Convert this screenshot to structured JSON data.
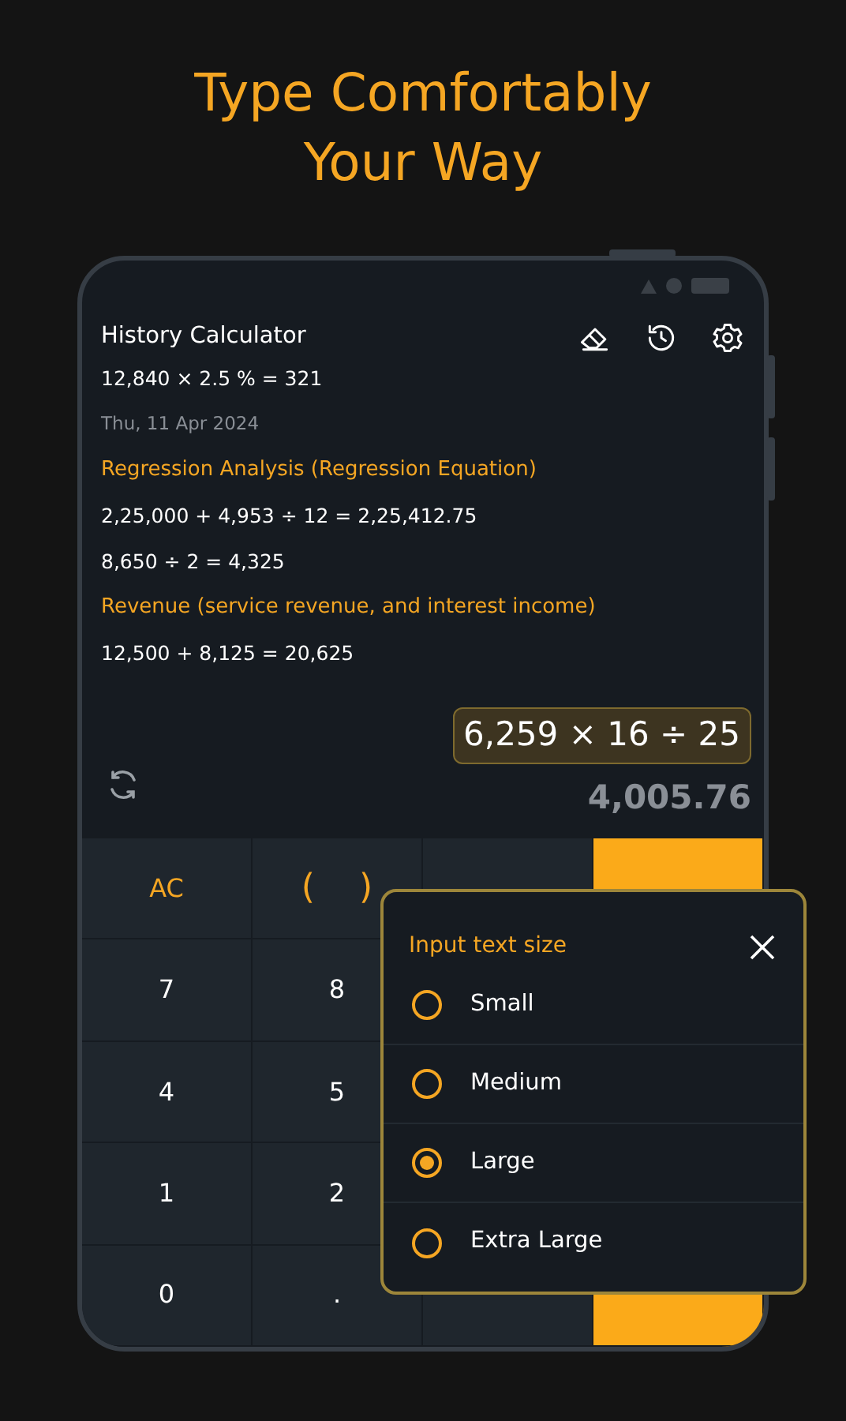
{
  "headline": [
    "Type Comfortably",
    "Your Way"
  ],
  "app": {
    "title": "History Calculator"
  },
  "history": [
    {
      "kind": "expression",
      "text": "12,840 × 2.5 % = 321"
    },
    {
      "kind": "date",
      "text": "Thu, 11 Apr 2024"
    },
    {
      "kind": "title",
      "text": "Regression Analysis (Regression Equation)"
    },
    {
      "kind": "expression",
      "text": "2,25,000 + 4,953 ÷ 12 = 2,25,412.75"
    },
    {
      "kind": "expression",
      "text": "8,650 ÷ 2 = 4,325"
    },
    {
      "kind": "title",
      "text": "Revenue (service revenue, and interest income)"
    },
    {
      "kind": "expression",
      "text": "12,500 + 8,125 = 20,625"
    }
  ],
  "display": {
    "expression": "6,259 × 16 ÷ 25",
    "result": "4,005.76"
  },
  "keypad": [
    [
      {
        "label": "AC",
        "kind": "function"
      },
      {
        "label": "(    )",
        "kind": "function"
      },
      {
        "kind": "function"
      },
      {
        "kind": "operator"
      }
    ],
    [
      {
        "label": "7",
        "kind": "digit"
      },
      {
        "label": "8",
        "kind": "digit"
      },
      {
        "kind": "digit"
      },
      {
        "kind": "operator"
      }
    ],
    [
      {
        "label": "4",
        "kind": "digit"
      },
      {
        "label": "5",
        "kind": "digit"
      },
      {
        "kind": "digit"
      },
      {
        "kind": "operator"
      }
    ],
    [
      {
        "label": "1",
        "kind": "digit"
      },
      {
        "label": "2",
        "kind": "digit"
      },
      {
        "kind": "digit"
      },
      {
        "kind": "operator"
      }
    ],
    [
      {
        "label": "0",
        "kind": "digit"
      },
      {
        "label": ".",
        "kind": "digit"
      },
      {
        "kind": "function"
      },
      {
        "kind": "operator"
      }
    ]
  ],
  "dialog": {
    "title": "Input text size",
    "options": [
      {
        "label": "Small",
        "selected": false
      },
      {
        "label": "Medium",
        "selected": false
      },
      {
        "label": "Large",
        "selected": true
      },
      {
        "label": "Extra Large",
        "selected": false
      }
    ]
  }
}
